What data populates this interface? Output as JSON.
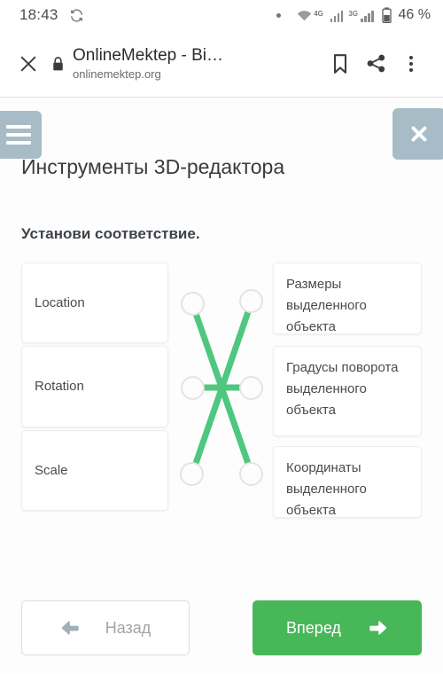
{
  "status_bar": {
    "time": "18:43",
    "sync_icon": "sync-icon",
    "dot_icon": "dot-indicator-icon",
    "wifi_icon": "wifi-icon",
    "wifi_label": "4G",
    "sim1_icon": "signal-bars-icon",
    "sim2_label": "3G",
    "sim2_icon": "signal-bars-icon",
    "battery_icon": "battery-icon",
    "battery": "46 %"
  },
  "browser_bar": {
    "close_icon": "close-icon",
    "lock_icon": "lock-icon",
    "title": "OnlineMektep - Bi…",
    "url": "onlinemektep.org",
    "bookmark_icon": "bookmark-icon",
    "share_icon": "share-icon",
    "menu_icon": "overflow-menu-icon"
  },
  "page": {
    "menu_button_icon": "hamburger-menu-icon",
    "close_button_icon": "close-icon",
    "button_color": "#a7bcc6",
    "title": "Инструменты 3D-редактора",
    "instruction": "Установи соответствие."
  },
  "match": {
    "left_items": [
      {
        "label": "Location"
      },
      {
        "label": "Rotation"
      },
      {
        "label": "Scale"
      }
    ],
    "right_items": [
      {
        "label": "Размеры выделенного объекта"
      },
      {
        "label": "Градусы поворота выделенного объекта"
      },
      {
        "label": "Координаты выделенного объекта"
      }
    ],
    "connections": [
      {
        "from": 0,
        "to": 2
      },
      {
        "from": 1,
        "to": 1
      },
      {
        "from": 2,
        "to": 0
      }
    ],
    "line_color": "#4ec77f",
    "node_border_color": "#e4e4e4"
  },
  "footer": {
    "back_label": "Назад",
    "back_icon": "arrow-left-icon",
    "next_label": "Вперед",
    "next_icon": "arrow-right-icon",
    "next_color": "#47b758"
  }
}
